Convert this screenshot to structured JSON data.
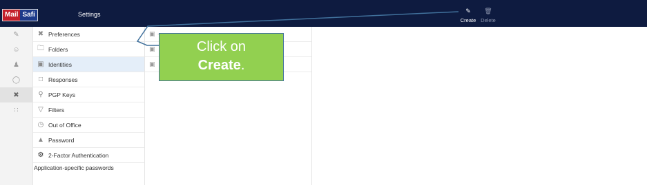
{
  "app": {
    "logo_part1": "Mail",
    "logo_part2": "Safi",
    "title": "Settings"
  },
  "toolbar": {
    "create_label": "Create",
    "delete_label": "Delete"
  },
  "rail": {
    "items": [
      {
        "icon": "compose-icon"
      },
      {
        "icon": "contacts-icon"
      },
      {
        "icon": "groups-icon"
      },
      {
        "icon": "globe-icon"
      },
      {
        "icon": "settings-tools-icon",
        "active": true
      },
      {
        "icon": "apps-grid-icon"
      }
    ]
  },
  "settings": {
    "items": [
      {
        "label": "Preferences",
        "icon": "tools-icon"
      },
      {
        "label": "Folders",
        "icon": "folder-icon"
      },
      {
        "label": "Identities",
        "icon": "id-card-icon",
        "active": true
      },
      {
        "label": "Responses",
        "icon": "chat-icon"
      },
      {
        "label": "PGP Keys",
        "icon": "key-icon"
      },
      {
        "label": "Filters",
        "icon": "filter-icon"
      },
      {
        "label": "Out of Office",
        "icon": "clock-icon"
      },
      {
        "label": "Password",
        "icon": "lock-icon"
      },
      {
        "label": "2-Factor Authentication",
        "icon": "gear-icon"
      }
    ],
    "extra_label": "Application-specific passwords"
  },
  "callout": {
    "line1": "Click on",
    "line2_bold": "Create",
    "line2_end": "."
  },
  "colors": {
    "topbar": "#0e1b40",
    "callout_fill": "#92d050",
    "callout_border": "#41719c",
    "active_item": "#e4eef9"
  }
}
